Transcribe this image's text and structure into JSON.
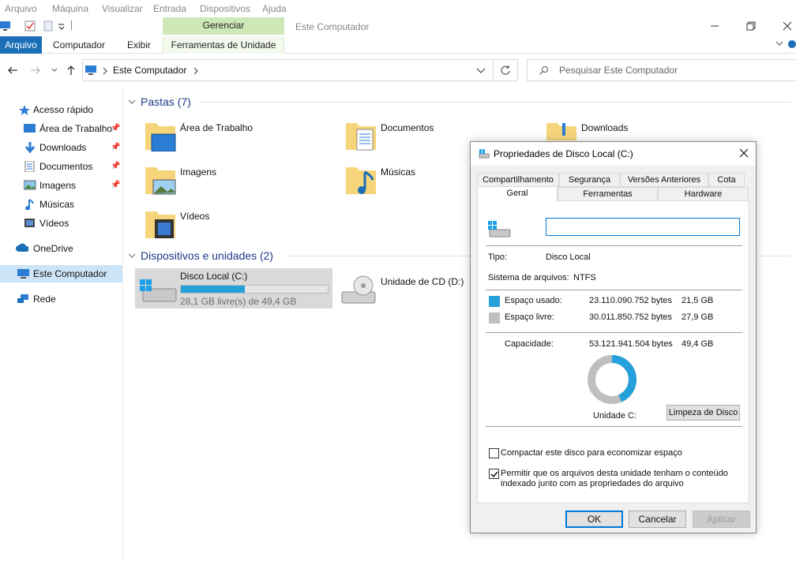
{
  "vm_menu": [
    "Arquivo",
    "Máquina",
    "Visualizar",
    "Entrada",
    "Dispositivos",
    "Ajuda"
  ],
  "ribbon": {
    "manage_tab": "Gerenciar",
    "window_title": "Este Computador",
    "tabs": {
      "file": "Arquivo",
      "computer": "Computador",
      "view": "Exibir",
      "drive_tools": "Ferramentas de Unidade"
    }
  },
  "address": {
    "path": "Este Computador",
    "search_placeholder": "Pesquisar Este Computador"
  },
  "sidebar": {
    "quick_access": "Acesso rápido",
    "items": [
      "Área de Trabalho",
      "Downloads",
      "Documentos",
      "Imagens",
      "Músicas",
      "Vídeos"
    ],
    "onedrive": "OneDrive",
    "this_pc": "Este Computador",
    "network": "Rede"
  },
  "main": {
    "folders_header": "Pastas (7)",
    "folders": [
      "Área de Trabalho",
      "Documentos",
      "Downloads",
      "Imagens",
      "Músicas",
      "Vídeos"
    ],
    "devices_header": "Dispositivos e unidades (2)",
    "drive_c": {
      "name": "Disco Local (C:)",
      "free": "28,1 GB livre(s) de 49,4 GB",
      "used_fraction": 0.435
    },
    "drive_d": {
      "name": "Unidade de CD (D:)"
    }
  },
  "dialog": {
    "title": "Propriedades de Disco Local (C:)",
    "tabs_row1": [
      "Compartilhamento",
      "Segurança",
      "Versões Anteriores",
      "Cota"
    ],
    "tabs_row2": [
      "Geral",
      "Ferramentas",
      "Hardware"
    ],
    "label_value": "",
    "type_label": "Tipo:",
    "type_value": "Disco Local",
    "fs_label": "Sistema de arquivos:",
    "fs_value": "NTFS",
    "used_label": "Espaço usado:",
    "used_bytes": "23.110.090.752 bytes",
    "used_gb": "21,5 GB",
    "free_label": "Espaço livre:",
    "free_bytes": "30.011.850.752 bytes",
    "free_gb": "27,9 GB",
    "capacity_label": "Capacidade:",
    "capacity_bytes": "53.121.941.504 bytes",
    "capacity_gb": "49,4 GB",
    "drive_label": "Unidade C:",
    "cleanup_button": "Limpeza de Disco",
    "compress_label": "Compactar este disco para economizar espaço",
    "index_label_1": "Permitir que os arquivos desta unidade tenham o conteúdo",
    "index_label_2": "indexado junto com as propriedades do arquivo",
    "ok": "OK",
    "cancel": "Cancelar",
    "apply": "Aplicar",
    "used_color": "#26a0da",
    "free_color": "#bfbfbf",
    "used_fraction": 0.435
  }
}
